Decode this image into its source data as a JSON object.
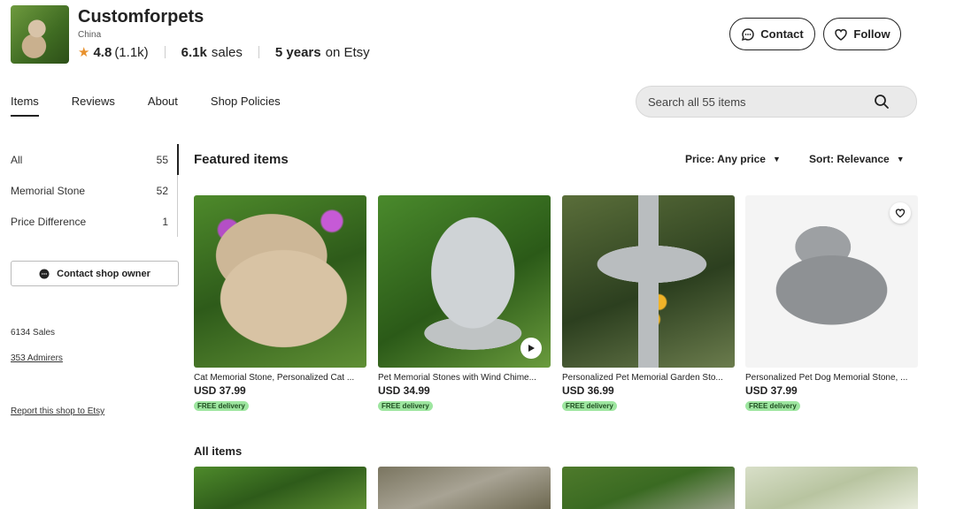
{
  "shop": {
    "name": "Customforpets",
    "location": "China",
    "rating": "4.8",
    "rating_count": "(1.1k)",
    "sales_strong": "6.1k",
    "sales_label": "sales",
    "years_strong": "5 years",
    "years_label": "on Etsy"
  },
  "header_buttons": {
    "contact": "Contact",
    "follow": "Follow"
  },
  "tabs": [
    {
      "label": "Items",
      "active": true
    },
    {
      "label": "Reviews"
    },
    {
      "label": "About"
    },
    {
      "label": "Shop Policies"
    }
  ],
  "search": {
    "placeholder": "Search all 55 items"
  },
  "sidebar": {
    "items": [
      {
        "label": "All",
        "count": "55"
      },
      {
        "label": "Memorial Stone",
        "count": "52"
      },
      {
        "label": "Price Difference",
        "count": "1"
      }
    ],
    "contact_owner": "Contact shop owner",
    "sales": "6134 Sales",
    "admirers": "353 Admirers",
    "report": "Report this shop to Etsy"
  },
  "featured": {
    "title": "Featured items",
    "price_filter": "Price: Any price",
    "sort_filter": "Sort: Relevance",
    "items": [
      {
        "title": "Cat Memorial Stone, Personalized Cat ...",
        "price": "USD 37.99",
        "badge": "FREE delivery"
      },
      {
        "title": "Pet Memorial Stones with Wind Chime...",
        "price": "USD 34.99",
        "badge": "FREE delivery"
      },
      {
        "title": "Personalized Pet Memorial Garden Sto...",
        "price": "USD 36.99",
        "badge": "FREE delivery"
      },
      {
        "title": "Personalized Pet Dog Memorial Stone, ...",
        "price": "USD 37.99",
        "badge": "FREE delivery"
      }
    ]
  },
  "all_items": {
    "title": "All items"
  },
  "colors": {
    "accent_star": "#e8912d",
    "badge_bg": "#9ee6a0"
  }
}
